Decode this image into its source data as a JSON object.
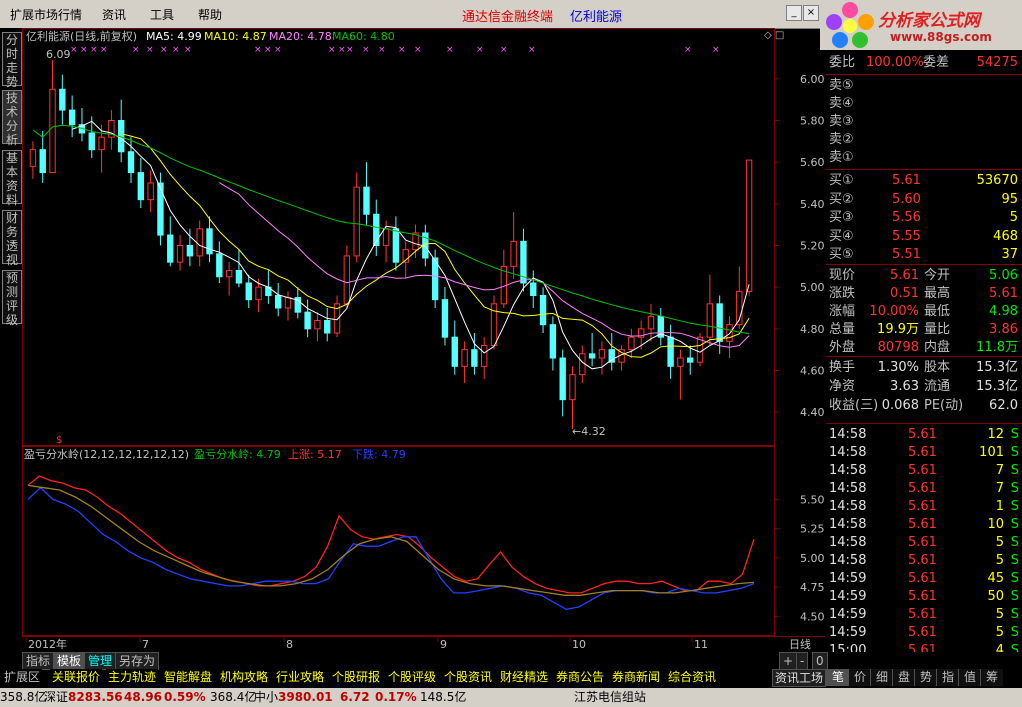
{
  "menu": {
    "items": [
      "扩展市场行情",
      "资讯",
      "工具",
      "帮助"
    ],
    "title_left": "通达信金融终端",
    "title_right": "亿利能源"
  },
  "logo": {
    "text1": "分析家公式网",
    "text2": "www.88gs.com"
  },
  "side_tabs": [
    "分时走势",
    "技术分析",
    "基本资料",
    "财务透视",
    "预测评级"
  ],
  "main_chart": {
    "header_name": "亿利能源(日线,前复权)",
    "ma5": "MA5: 4.99",
    "ma10": "MA10: 4.87",
    "ma20": "MA20: 4.78",
    "ma60": "MA60: 4.80",
    "high_label": "6.09",
    "low_label": "4.32",
    "y_ticks": [
      "6.00",
      "5.80",
      "5.60",
      "5.40",
      "5.20",
      "5.00",
      "4.80",
      "4.60",
      "4.40"
    ],
    "colors": {
      "up": "#ff3232",
      "down": "#54ffff",
      "ma5": "#ffffff",
      "ma10": "#ffff00",
      "ma20": "#ff80ff",
      "ma60": "#00c000"
    }
  },
  "sub_chart": {
    "name": "盈亏分水岭(12,12,12,12,12,12)",
    "v1": "盈亏分水岭: 4.79",
    "v2": "上涨: 5.17",
    "v3": "下跌: 4.79",
    "y_ticks": [
      "5.50",
      "5.25",
      "5.00",
      "4.75",
      "4.50"
    ]
  },
  "x_axis": {
    "labels": [
      "2012年",
      "7",
      "8",
      "9",
      "10",
      "11"
    ],
    "period": "日线"
  },
  "chart_data": {
    "type": "candlestick",
    "ylim": [
      4.3,
      6.1
    ],
    "candles": [
      [
        5.58,
        5.7,
        5.52,
        5.66
      ],
      [
        5.66,
        5.75,
        5.5,
        5.55
      ],
      [
        5.55,
        6.09,
        5.55,
        5.95
      ],
      [
        5.95,
        6.02,
        5.78,
        5.85
      ],
      [
        5.85,
        5.92,
        5.72,
        5.78
      ],
      [
        5.78,
        5.86,
        5.7,
        5.74
      ],
      [
        5.74,
        5.82,
        5.62,
        5.66
      ],
      [
        5.66,
        5.78,
        5.55,
        5.72
      ],
      [
        5.72,
        5.85,
        5.66,
        5.8
      ],
      [
        5.8,
        5.9,
        5.6,
        5.65
      ],
      [
        5.65,
        5.72,
        5.5,
        5.55
      ],
      [
        5.55,
        5.62,
        5.38,
        5.42
      ],
      [
        5.42,
        5.56,
        5.36,
        5.5
      ],
      [
        5.5,
        5.55,
        5.2,
        5.25
      ],
      [
        5.25,
        5.34,
        5.1,
        5.12
      ],
      [
        5.12,
        5.25,
        5.08,
        5.2
      ],
      [
        5.2,
        5.28,
        5.1,
        5.15
      ],
      [
        5.15,
        5.32,
        5.1,
        5.28
      ],
      [
        5.28,
        5.34,
        5.12,
        5.16
      ],
      [
        5.16,
        5.22,
        5.02,
        5.05
      ],
      [
        5.05,
        5.12,
        4.96,
        5.08
      ],
      [
        5.08,
        5.18,
        5.0,
        5.02
      ],
      [
        5.02,
        5.06,
        4.9,
        4.94
      ],
      [
        4.94,
        5.04,
        4.88,
        5.0
      ],
      [
        5.0,
        5.08,
        4.92,
        4.96
      ],
      [
        4.96,
        5.02,
        4.86,
        4.9
      ],
      [
        4.9,
        4.98,
        4.84,
        4.95
      ],
      [
        4.95,
        5.0,
        4.85,
        4.88
      ],
      [
        4.88,
        4.94,
        4.76,
        4.8
      ],
      [
        4.8,
        4.88,
        4.74,
        4.84
      ],
      [
        4.84,
        4.9,
        4.74,
        4.78
      ],
      [
        4.78,
        4.96,
        4.76,
        4.92
      ],
      [
        4.92,
        5.2,
        4.9,
        5.15
      ],
      [
        5.15,
        5.55,
        5.12,
        5.48
      ],
      [
        5.48,
        5.6,
        5.3,
        5.35
      ],
      [
        5.35,
        5.42,
        5.15,
        5.2
      ],
      [
        5.2,
        5.32,
        5.12,
        5.28
      ],
      [
        5.28,
        5.34,
        5.08,
        5.12
      ],
      [
        5.12,
        5.22,
        5.04,
        5.18
      ],
      [
        5.18,
        5.3,
        5.14,
        5.26
      ],
      [
        5.26,
        5.3,
        5.1,
        5.14
      ],
      [
        5.14,
        5.18,
        4.9,
        4.94
      ],
      [
        4.94,
        5.0,
        4.72,
        4.76
      ],
      [
        4.76,
        4.84,
        4.58,
        4.62
      ],
      [
        4.62,
        4.74,
        4.54,
        4.7
      ],
      [
        4.7,
        4.78,
        4.58,
        4.62
      ],
      [
        4.62,
        4.76,
        4.56,
        4.72
      ],
      [
        4.72,
        4.96,
        4.7,
        4.92
      ],
      [
        4.92,
        5.18,
        4.9,
        5.1
      ],
      [
        5.1,
        5.36,
        5.04,
        5.22
      ],
      [
        5.22,
        5.28,
        4.98,
        5.02
      ],
      [
        5.02,
        5.08,
        4.9,
        4.96
      ],
      [
        4.96,
        5.0,
        4.78,
        4.82
      ],
      [
        4.82,
        4.86,
        4.6,
        4.66
      ],
      [
        4.66,
        4.7,
        4.38,
        4.46
      ],
      [
        4.46,
        4.62,
        4.32,
        4.58
      ],
      [
        4.58,
        4.72,
        4.54,
        4.68
      ],
      [
        4.68,
        4.78,
        4.62,
        4.66
      ],
      [
        4.66,
        4.74,
        4.58,
        4.7
      ],
      [
        4.7,
        4.78,
        4.6,
        4.64
      ],
      [
        4.64,
        4.72,
        4.6,
        4.7
      ],
      [
        4.7,
        4.8,
        4.66,
        4.76
      ],
      [
        4.76,
        4.84,
        4.7,
        4.8
      ],
      [
        4.8,
        4.92,
        4.74,
        4.86
      ],
      [
        4.86,
        4.9,
        4.72,
        4.76
      ],
      [
        4.76,
        4.82,
        4.56,
        4.62
      ],
      [
        4.62,
        4.7,
        4.46,
        4.66
      ],
      [
        4.66,
        4.72,
        4.58,
        4.64
      ],
      [
        4.64,
        4.78,
        4.62,
        4.76
      ],
      [
        4.76,
        5.06,
        4.72,
        4.92
      ],
      [
        4.92,
        4.96,
        4.68,
        4.74
      ],
      [
        4.74,
        4.86,
        4.66,
        4.82
      ],
      [
        4.82,
        5.1,
        4.8,
        4.98
      ],
      [
        4.98,
        5.61,
        4.96,
        5.61
      ]
    ],
    "sub_series": {
      "red": [
        5.62,
        5.7,
        5.66,
        5.64,
        5.6,
        5.58,
        5.52,
        5.44,
        5.38,
        5.3,
        5.22,
        5.14,
        5.06,
        5.0,
        4.96,
        4.9,
        4.86,
        4.82,
        4.8,
        4.78,
        4.76,
        4.76,
        4.78,
        4.8,
        4.84,
        4.92,
        5.1,
        5.36,
        5.24,
        5.18,
        5.16,
        5.18,
        5.2,
        5.18,
        5.1,
        5.0,
        4.92,
        4.84,
        4.8,
        4.82,
        4.94,
        5.05,
        4.92,
        4.84,
        4.78,
        4.74,
        4.72,
        4.7,
        4.7,
        4.74,
        4.78,
        4.8,
        4.8,
        4.78,
        4.78,
        4.8,
        4.76,
        4.72,
        4.72,
        4.8,
        4.8,
        4.78,
        4.86,
        5.16
      ],
      "blue": [
        5.5,
        5.6,
        5.5,
        5.46,
        5.4,
        5.3,
        5.2,
        5.14,
        5.06,
        5.0,
        4.96,
        4.9,
        4.86,
        4.82,
        4.8,
        4.78,
        4.76,
        4.76,
        4.78,
        4.8,
        4.8,
        4.8,
        4.78,
        4.78,
        4.82,
        4.98,
        5.12,
        5.1,
        5.1,
        5.14,
        5.18,
        5.18,
        5.0,
        4.82,
        4.7,
        4.7,
        4.72,
        4.74,
        4.76,
        4.74,
        4.7,
        4.68,
        4.62,
        4.56,
        4.58,
        4.64,
        4.7,
        4.72,
        4.72,
        4.72,
        4.7,
        4.7,
        4.74,
        4.72,
        4.7,
        4.7,
        4.72,
        4.74,
        4.78
      ],
      "yellow": [
        5.62,
        5.6,
        5.58,
        5.52,
        5.44,
        5.34,
        5.24,
        5.14,
        5.06,
        5.0,
        4.94,
        4.88,
        4.84,
        4.8,
        4.78,
        4.76,
        4.76,
        4.78,
        4.82,
        4.9,
        5.02,
        5.12,
        5.16,
        5.18,
        5.14,
        5.02,
        4.9,
        4.82,
        4.78,
        4.76,
        4.76,
        4.74,
        4.72,
        4.7,
        4.68,
        4.68,
        4.7,
        4.72,
        4.72,
        4.72,
        4.7,
        4.7,
        4.72,
        4.74,
        4.76,
        4.78,
        4.79
      ]
    }
  },
  "quote": {
    "weibi_label": "委比",
    "weibi": "100.00%",
    "weicha_label": "委差",
    "weicha": "54275",
    "sell": [
      {
        "label": "卖⑤",
        "price": "",
        "vol": ""
      },
      {
        "label": "卖④",
        "price": "",
        "vol": ""
      },
      {
        "label": "卖③",
        "price": "",
        "vol": ""
      },
      {
        "label": "卖②",
        "price": "",
        "vol": ""
      },
      {
        "label": "卖①",
        "price": "",
        "vol": ""
      }
    ],
    "buy": [
      {
        "label": "买①",
        "price": "5.61",
        "vol": "53670"
      },
      {
        "label": "买②",
        "price": "5.60",
        "vol": "95"
      },
      {
        "label": "买③",
        "price": "5.56",
        "vol": "5"
      },
      {
        "label": "买④",
        "price": "5.55",
        "vol": "468"
      },
      {
        "label": "买⑤",
        "price": "5.51",
        "vol": "37"
      }
    ],
    "stats": [
      {
        "l1": "现价",
        "v1": "5.61",
        "c1": "red",
        "l2": "今开",
        "v2": "5.06",
        "c2": "green"
      },
      {
        "l1": "涨跌",
        "v1": "0.51",
        "c1": "red",
        "l2": "最高",
        "v2": "5.61",
        "c2": "red"
      },
      {
        "l1": "涨幅",
        "v1": "10.00%",
        "c1": "red",
        "l2": "最低",
        "v2": "4.98",
        "c2": "green"
      },
      {
        "l1": "总量",
        "v1": "19.9万",
        "c1": "yellow",
        "l2": "量比",
        "v2": "3.86",
        "c2": "red"
      },
      {
        "l1": "外盘",
        "v1": "80798",
        "c1": "red",
        "l2": "内盘",
        "v2": "11.8万",
        "c2": "green"
      }
    ],
    "stats2": [
      {
        "l1": "换手",
        "v1": "1.30%",
        "l2": "股本",
        "v2": "15.3亿"
      },
      {
        "l1": "净资",
        "v1": "3.63",
        "l2": "流通",
        "v2": "15.3亿"
      },
      {
        "l1": "收益(三)",
        "v1": "0.068",
        "l2": "PE(动)",
        "v2": "62.0"
      }
    ],
    "ticks": [
      [
        "14:58",
        "5.61",
        "12",
        "S"
      ],
      [
        "14:58",
        "5.61",
        "101",
        "S"
      ],
      [
        "14:58",
        "5.61",
        "7",
        "S"
      ],
      [
        "14:58",
        "5.61",
        "7",
        "S"
      ],
      [
        "14:58",
        "5.61",
        "1",
        "S"
      ],
      [
        "14:58",
        "5.61",
        "10",
        "S"
      ],
      [
        "14:58",
        "5.61",
        "5",
        "S"
      ],
      [
        "14:58",
        "5.61",
        "5",
        "S"
      ],
      [
        "14:59",
        "5.61",
        "45",
        "S"
      ],
      [
        "14:59",
        "5.61",
        "50",
        "S"
      ],
      [
        "14:59",
        "5.61",
        "5",
        "S"
      ],
      [
        "14:59",
        "5.61",
        "5",
        "S"
      ],
      [
        "15:00",
        "5.61",
        "4",
        "S"
      ]
    ]
  },
  "bottom_tabs": [
    "指标",
    "模板",
    "管理",
    "另存为"
  ],
  "bottom_nav": [
    "扩展区",
    "关联报价",
    "主力轨迹",
    "智能解盘",
    "机构攻略",
    "行业攻略",
    "个股研报",
    "个股评级",
    "个股资讯",
    "财经精选",
    "券商公告",
    "券商新闻",
    "综合资讯"
  ],
  "zoom_buttons": [
    "+",
    "-",
    "0"
  ],
  "right_tabs": [
    "资讯工场",
    "笔",
    "价",
    "细",
    "盘",
    "势",
    "指",
    "值",
    "筹"
  ],
  "status": {
    "s1": "358.8亿",
    "szlabel": "深证",
    "szval": "8283.56",
    "szchg": "48.96",
    "szpct": "0.59%",
    "s2": "368.4亿",
    "zxlabel": "中小",
    "zxval": "3980.01",
    "zxchg": "6.72",
    "zxpct": "0.17%",
    "s3": "148.5亿",
    "site": "江苏电信组站"
  }
}
